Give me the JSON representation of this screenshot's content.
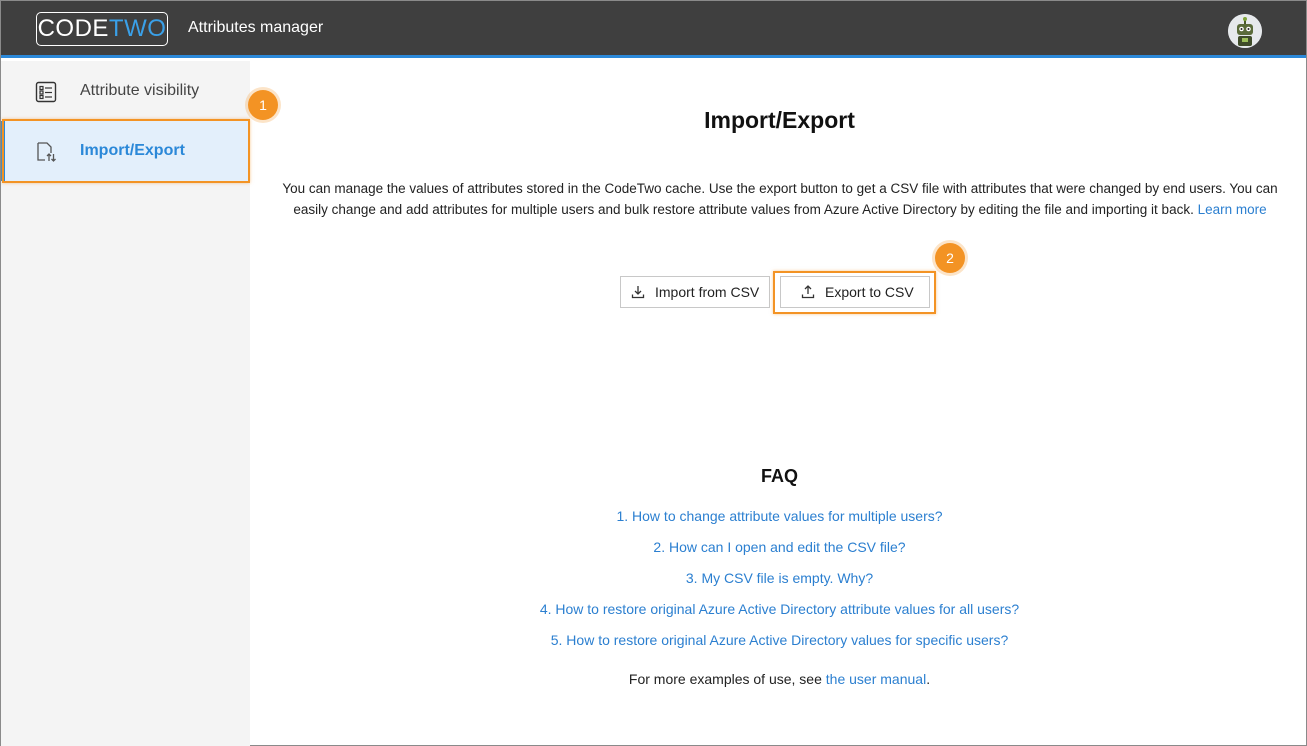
{
  "header": {
    "logo_code": "CODE",
    "logo_two": "TWO",
    "app_title": "Attributes manager",
    "accent_color": "#2b88d8"
  },
  "sidebar": {
    "items": [
      {
        "label": "Attribute visibility",
        "icon": "list-icon",
        "active": false
      },
      {
        "label": "Import/Export",
        "icon": "import-export-file-icon",
        "active": true
      }
    ]
  },
  "callouts": {
    "first": "1",
    "second": "2",
    "color": "#f39324"
  },
  "main": {
    "title": "Import/Export",
    "description": "You can manage the values of attributes stored in the CodeTwo cache. Use the export button to get a CSV file with attributes that were changed by end users. You can easily change and add attributes for multiple users and bulk restore attribute values from Azure Active Directory by editing the file and importing it back.",
    "learn_more": "Learn more",
    "import_label": "Import from CSV",
    "export_label": "Export to CSV"
  },
  "faq": {
    "title": "FAQ",
    "items": [
      "1. How to change attribute values for multiple users?",
      "2. How can I open and edit the CSV file?",
      "3. My CSV file is empty. Why?",
      "4. How to restore original Azure Active Directory attribute values for all users?",
      "5. How to restore original Azure Active Directory values for specific users?"
    ],
    "more_prefix": "For more examples of use, see ",
    "more_link": "the user manual",
    "more_suffix": "."
  }
}
